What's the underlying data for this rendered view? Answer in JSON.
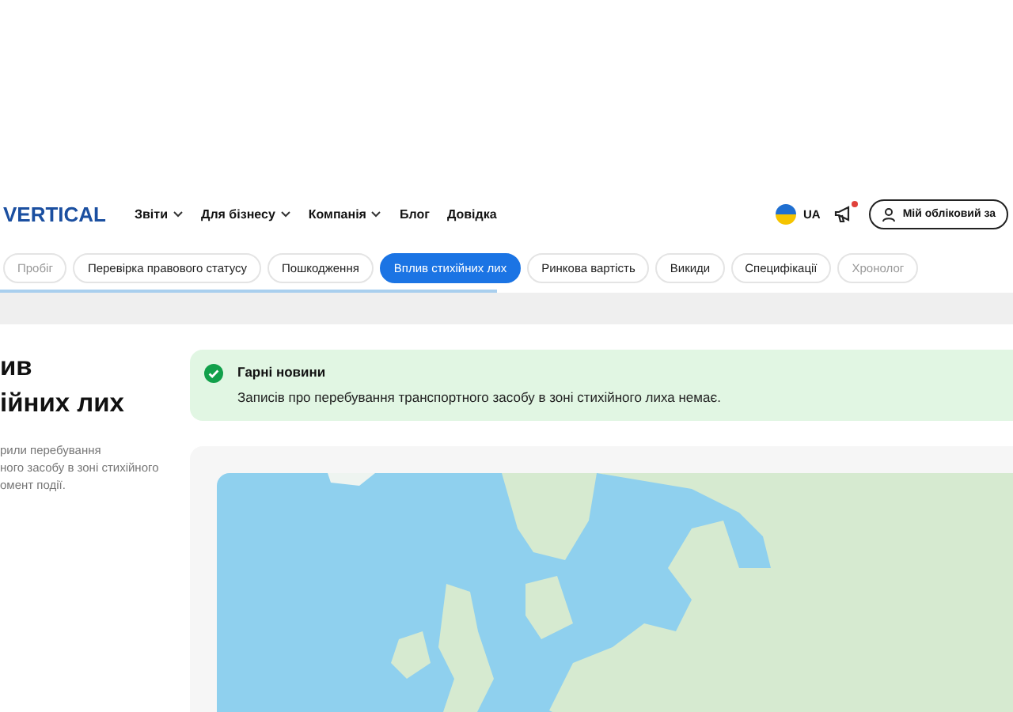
{
  "header": {
    "logo": "VERTICAL",
    "nav": [
      {
        "label": "Звіти",
        "dropdown": true
      },
      {
        "label": "Для бізнесу",
        "dropdown": true
      },
      {
        "label": "Компанія",
        "dropdown": true
      },
      {
        "label": "Блог",
        "dropdown": false
      },
      {
        "label": "Довідка",
        "dropdown": false
      }
    ],
    "language": "UA",
    "notification_dot": true,
    "account_button": "Мій обліковий за"
  },
  "tabs": [
    {
      "label": "Пробіг",
      "selected": false
    },
    {
      "label": "Перевірка правового статусу",
      "selected": false
    },
    {
      "label": "Пошкодження",
      "selected": false
    },
    {
      "label": "Вплив стихійних лих",
      "selected": true
    },
    {
      "label": "Ринкова вартість",
      "selected": false
    },
    {
      "label": "Викиди",
      "selected": false
    },
    {
      "label": "Специфікації",
      "selected": false
    },
    {
      "label": "Хронолог",
      "selected": false
    }
  ],
  "tab_progress": {
    "level": 0.49
  },
  "section": {
    "title_lines": [
      "ив",
      "ійних лих"
    ],
    "description_lines": [
      "рили перебування",
      "ного засобу в зоні стихійного",
      "омент події."
    ]
  },
  "alert": {
    "kind": "success",
    "title": "Гарні новини",
    "message": "Записів про перебування транспортного засобу в зоні стихійного лиха немає."
  }
}
